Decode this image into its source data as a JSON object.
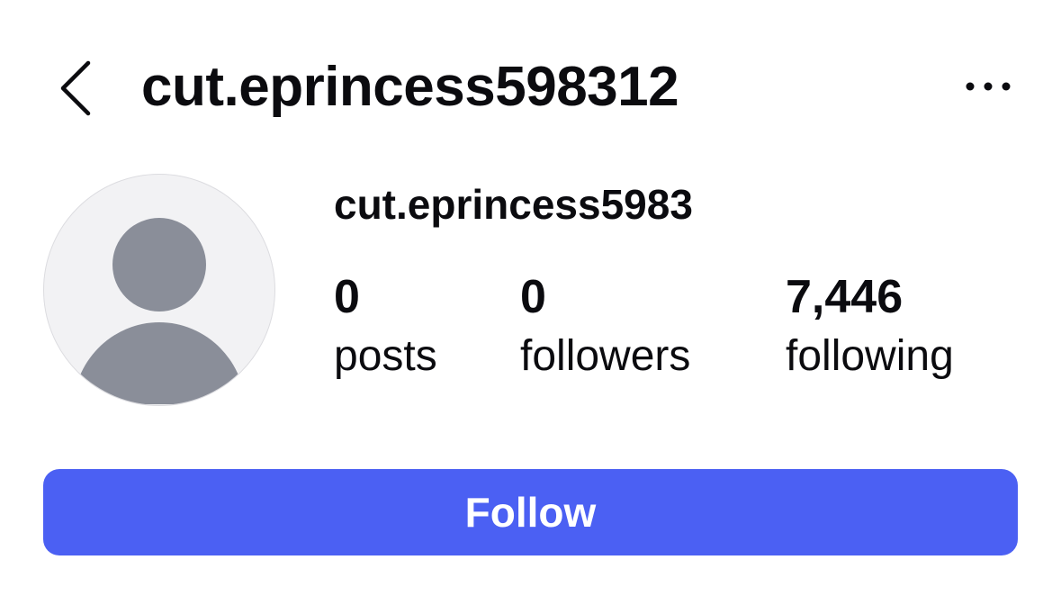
{
  "header": {
    "title": "cut.eprincess598312",
    "back_icon": "chevron-left-icon",
    "more_icon": "ellipsis-horizontal-icon"
  },
  "profile": {
    "avatar_icon": "default-avatar-icon",
    "name": "cut.eprincess5983",
    "stats": {
      "posts": {
        "count": "0",
        "label": "posts"
      },
      "followers": {
        "count": "0",
        "label": "followers"
      },
      "following": {
        "count": "7,446",
        "label": "following"
      }
    }
  },
  "actions": {
    "follow_label": "Follow"
  },
  "colors": {
    "accent": "#4b60f3",
    "text": "#0b0b0f",
    "avatar_bg": "#f2f2f4",
    "avatar_figure": "#8a8e99"
  }
}
